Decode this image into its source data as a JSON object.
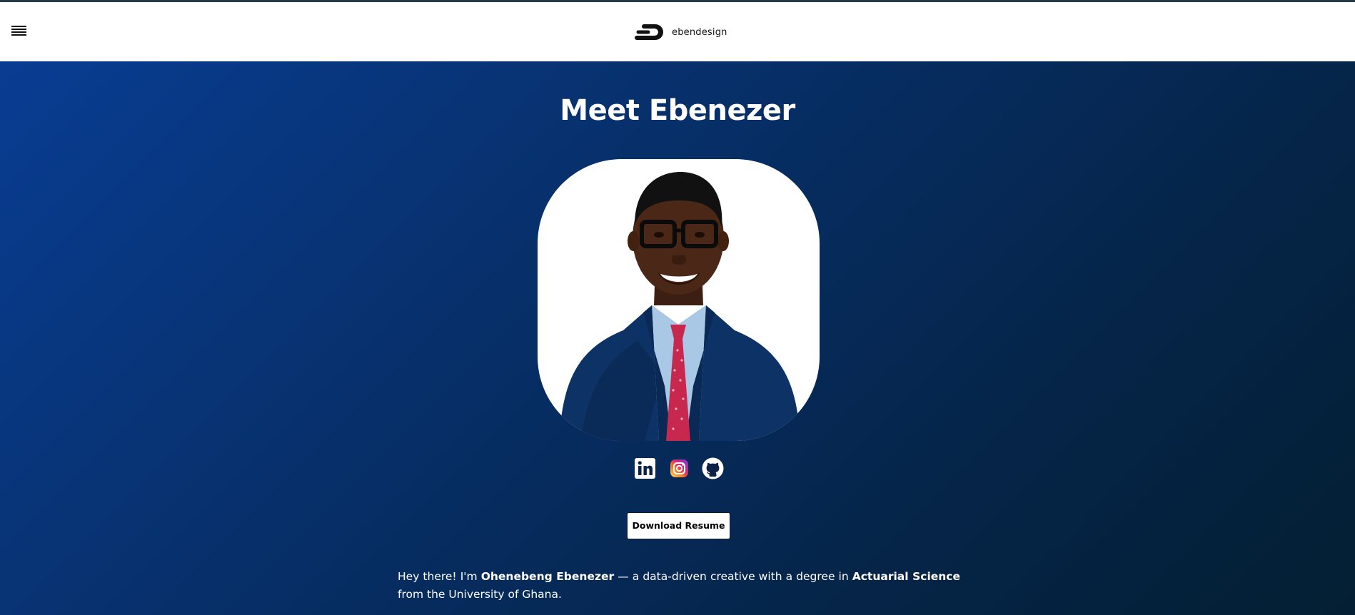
{
  "header": {
    "menu_icon": "hamburger-menu-icon",
    "logo_text": "ebendesign"
  },
  "hero": {
    "title": "Meet Ebenezer",
    "portrait_alt": "Portrait of Ohenebeng Ebenezer"
  },
  "socials": [
    {
      "name": "LinkedIn",
      "icon": "linkedin-icon"
    },
    {
      "name": "Instagram",
      "icon": "instagram-icon"
    },
    {
      "name": "GitHub",
      "icon": "github-icon"
    }
  ],
  "resume_button": {
    "label": "Download Resume"
  },
  "intro": {
    "part1": "Hey there! I'm ",
    "name": "Ohenebeng Ebenezer",
    "part2": " — a data-driven creative with a degree in ",
    "degree": "Actuarial Science",
    "part3": " from the University of Ghana."
  },
  "colors": {
    "gradient_start": "#093d93",
    "gradient_end": "#041f33",
    "header_bg": "#ffffff",
    "button_bg": "#ffffff"
  }
}
